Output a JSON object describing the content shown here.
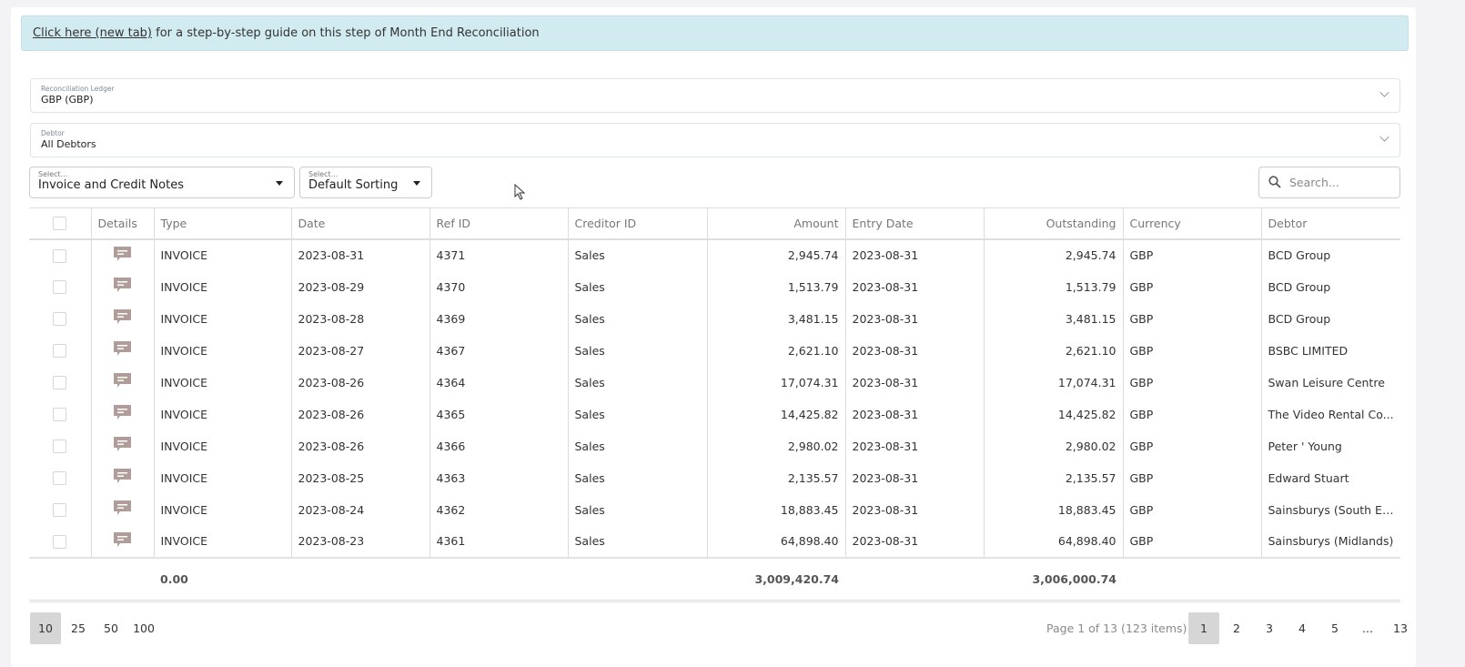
{
  "banner": {
    "link": "Click here (new tab)",
    "text": " for a step-by-step guide on this step of Month End Reconciliation"
  },
  "ledger": {
    "label": "Reconciliation Ledger",
    "value": "GBP (GBP)"
  },
  "debtor": {
    "label": "Debtor",
    "value": "All Debtors"
  },
  "filter_type": {
    "label": "Select...",
    "value": "Invoice and Credit Notes"
  },
  "sorting": {
    "label": "Select...",
    "value": "Default Sorting"
  },
  "search": {
    "placeholder": "Search..."
  },
  "columns": [
    "Details",
    "Type",
    "Date",
    "Ref ID",
    "Creditor ID",
    "Amount",
    "Entry Date",
    "Outstanding",
    "Currency",
    "Debtor"
  ],
  "rows": [
    [
      "INVOICE",
      "2023-08-31",
      "4371",
      "Sales",
      "2,945.74",
      "2023-08-31",
      "2,945.74",
      "GBP",
      "BCD Group"
    ],
    [
      "INVOICE",
      "2023-08-29",
      "4370",
      "Sales",
      "1,513.79",
      "2023-08-31",
      "1,513.79",
      "GBP",
      "BCD Group"
    ],
    [
      "INVOICE",
      "2023-08-28",
      "4369",
      "Sales",
      "3,481.15",
      "2023-08-31",
      "3,481.15",
      "GBP",
      "BCD Group"
    ],
    [
      "INVOICE",
      "2023-08-27",
      "4367",
      "Sales",
      "2,621.10",
      "2023-08-31",
      "2,621.10",
      "GBP",
      "BSBC LIMITED"
    ],
    [
      "INVOICE",
      "2023-08-26",
      "4364",
      "Sales",
      "17,074.31",
      "2023-08-31",
      "17,074.31",
      "GBP",
      "Swan Leisure Centre"
    ],
    [
      "INVOICE",
      "2023-08-26",
      "4365",
      "Sales",
      "14,425.82",
      "2023-08-31",
      "14,425.82",
      "GBP",
      "The Video Rental Co..."
    ],
    [
      "INVOICE",
      "2023-08-26",
      "4366",
      "Sales",
      "2,980.02",
      "2023-08-31",
      "2,980.02",
      "GBP",
      "Peter ' Young"
    ],
    [
      "INVOICE",
      "2023-08-25",
      "4363",
      "Sales",
      "2,135.57",
      "2023-08-31",
      "2,135.57",
      "GBP",
      "Edward Stuart"
    ],
    [
      "INVOICE",
      "2023-08-24",
      "4362",
      "Sales",
      "18,883.45",
      "2023-08-31",
      "18,883.45",
      "GBP",
      "Sainsburys (South Ea..."
    ],
    [
      "INVOICE",
      "2023-08-23",
      "4361",
      "Sales",
      "64,898.40",
      "2023-08-31",
      "64,898.40",
      "GBP",
      "Sainsburys (Midlands)"
    ]
  ],
  "totals": {
    "type": "0.00",
    "amount": "3,009,420.74",
    "outstanding": "3,006,000.74"
  },
  "page_sizes": [
    "10",
    "25",
    "50",
    "100"
  ],
  "page_info": "Page 1 of 13 (123 items)",
  "pages": [
    "1",
    "2",
    "3",
    "4",
    "5",
    "...",
    "13"
  ],
  "colors": {
    "banner": "#d1ebf0",
    "details_icon": "#b09c98"
  }
}
